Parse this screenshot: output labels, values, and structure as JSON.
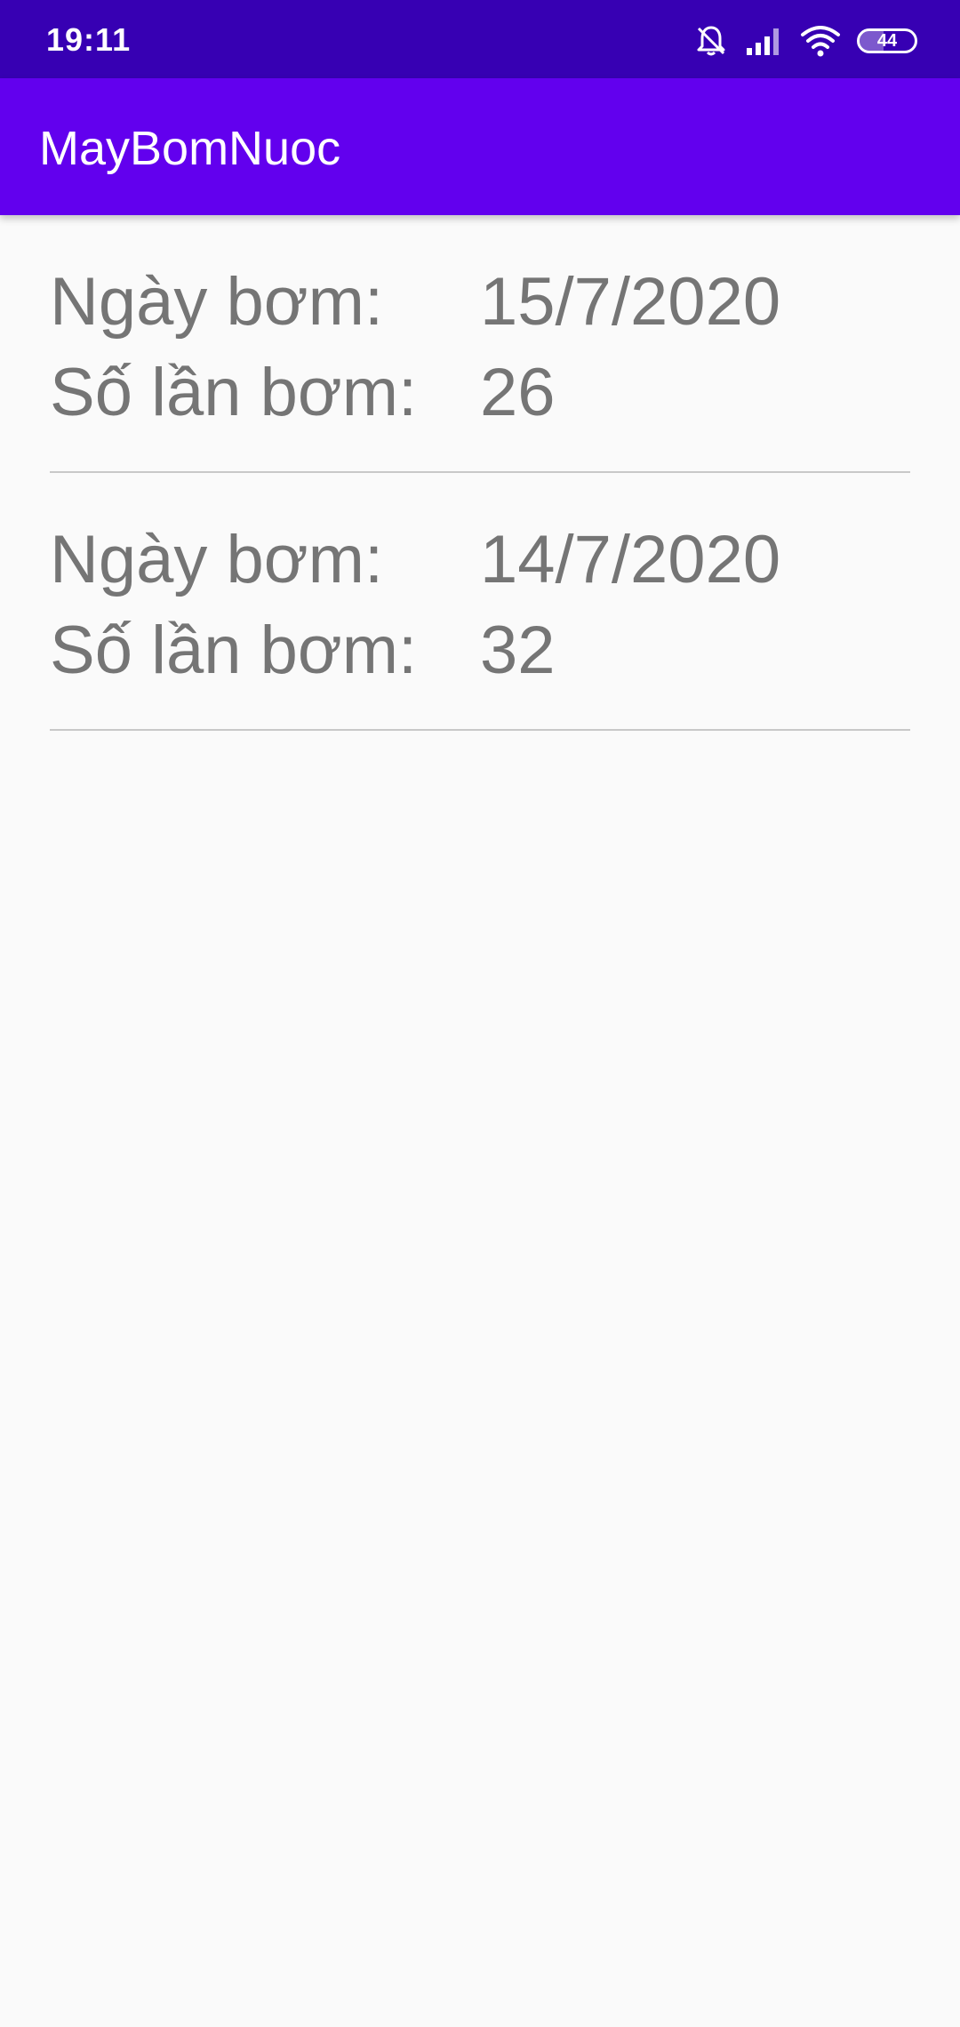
{
  "status_bar": {
    "time": "19:11",
    "battery_level": "44",
    "icons": [
      "silent-bell-icon",
      "signal-icon",
      "wifi-icon",
      "battery-icon"
    ]
  },
  "app_bar": {
    "title": "MayBomNuoc"
  },
  "records": [
    {
      "date_label": "Ngày bơm:",
      "date_value": "15/7/2020",
      "count_label": "Số lần bơm:",
      "count_value": "26"
    },
    {
      "date_label": "Ngày bơm:",
      "date_value": "14/7/2020",
      "count_label": "Số lần bơm:",
      "count_value": "32"
    }
  ],
  "colors": {
    "status_bar": "#3700b3",
    "app_bar": "#6200ee",
    "background": "#fafafa",
    "text": "#757575",
    "divider": "#c8c8c8"
  }
}
